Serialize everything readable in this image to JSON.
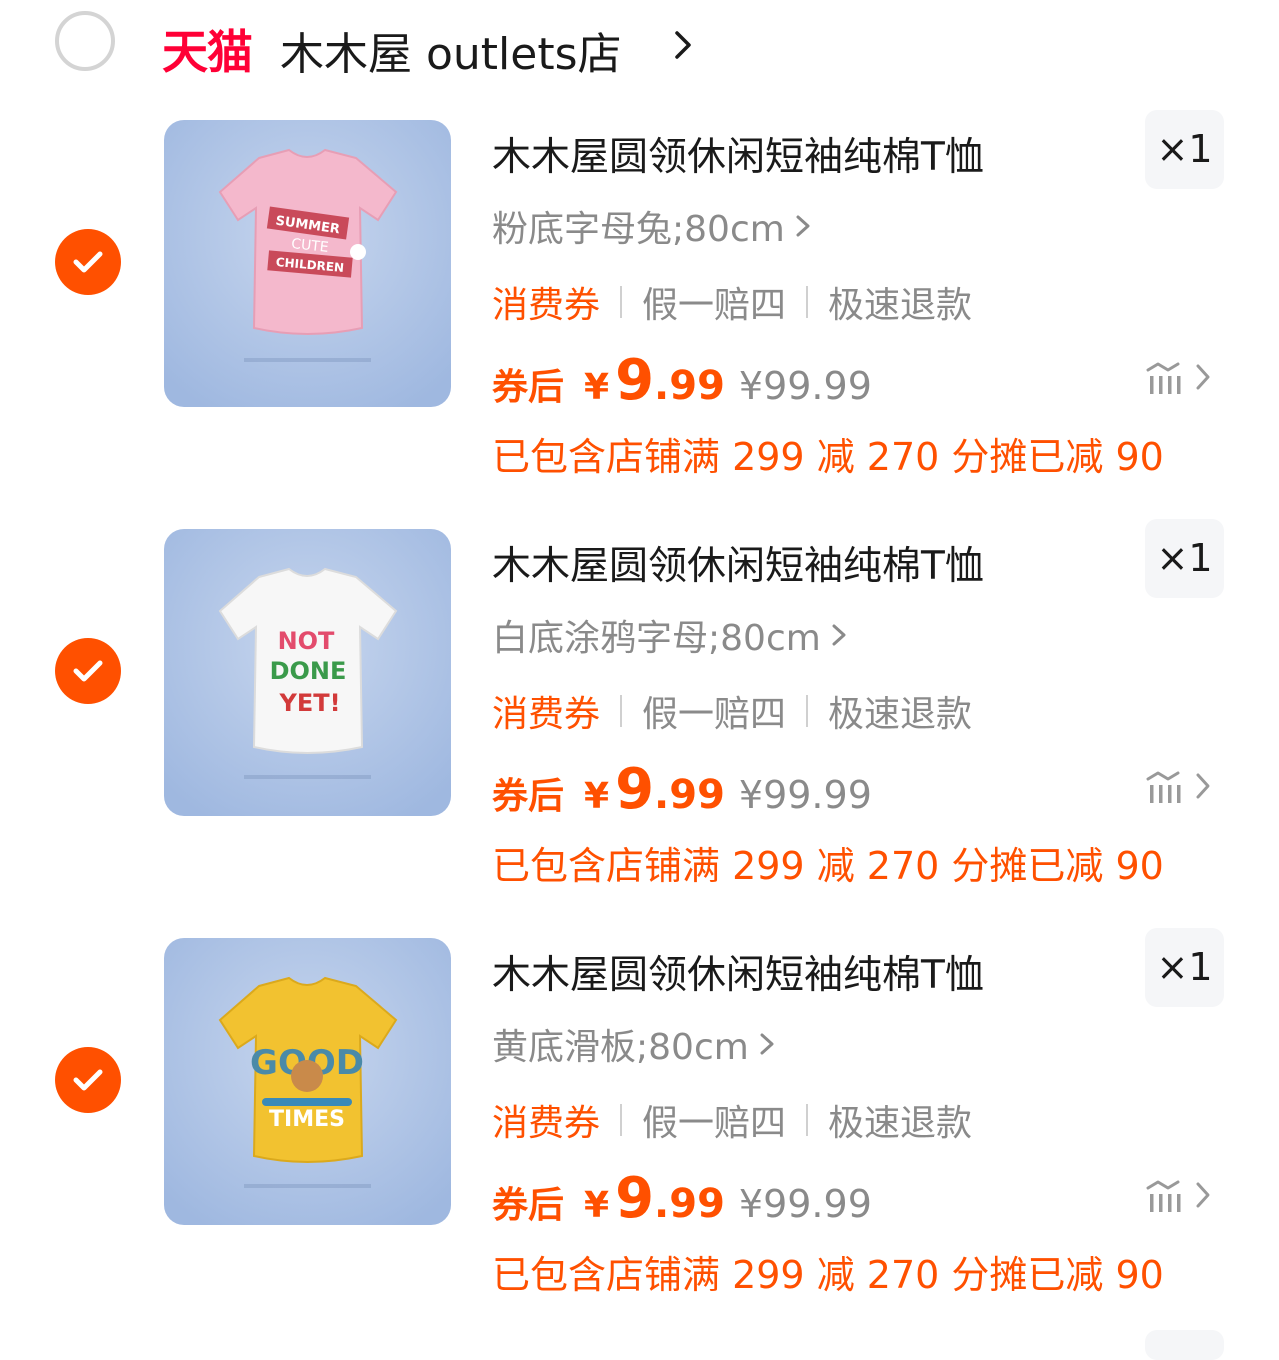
{
  "store": {
    "brand": "天猫",
    "name": "木木屋 outlets店",
    "colors": {
      "brand": "#ff0036"
    }
  },
  "colors": {
    "accent": "#ff5000",
    "muted": "#8a8a8a"
  },
  "items": [
    {
      "title": "木木屋圆领休闲短袖纯棉T恤",
      "quantity": "×1",
      "sku": "粉底字母兔;80cm",
      "tags": [
        "消费券",
        "假一赔四",
        "极速退款"
      ],
      "price_label": "券后",
      "currency": "¥",
      "price_int": "9",
      "price_dec": ".99",
      "original_price": "¥99.99",
      "discount_note": "已包含店铺满 299 减 270 分摊已减 90",
      "shirt_color": "#f4b8cc",
      "shirt_text": [
        "SUMMER",
        "CUTE",
        "CHILDREN"
      ],
      "selected": true
    },
    {
      "title": "木木屋圆领休闲短袖纯棉T恤",
      "quantity": "×1",
      "sku": "白底涂鸦字母;80cm",
      "tags": [
        "消费券",
        "假一赔四",
        "极速退款"
      ],
      "price_label": "券后",
      "currency": "¥",
      "price_int": "9",
      "price_dec": ".99",
      "original_price": "¥99.99",
      "discount_note": "已包含店铺满 299 减 270 分摊已减 90",
      "shirt_color": "#f7f7f7",
      "shirt_text": [
        "NOT",
        "DONE",
        "YET!"
      ],
      "selected": true
    },
    {
      "title": "木木屋圆领休闲短袖纯棉T恤",
      "quantity": "×1",
      "sku": "黄底滑板;80cm",
      "tags": [
        "消费券",
        "假一赔四",
        "极速退款"
      ],
      "price_label": "券后",
      "currency": "¥",
      "price_int": "9",
      "price_dec": ".99",
      "original_price": "¥99.99",
      "discount_note": "已包含店铺满 299 减 270 分摊已减 90",
      "shirt_color": "#f2c230",
      "shirt_text": [
        "GOOD",
        "TIMES"
      ],
      "selected": true
    }
  ]
}
